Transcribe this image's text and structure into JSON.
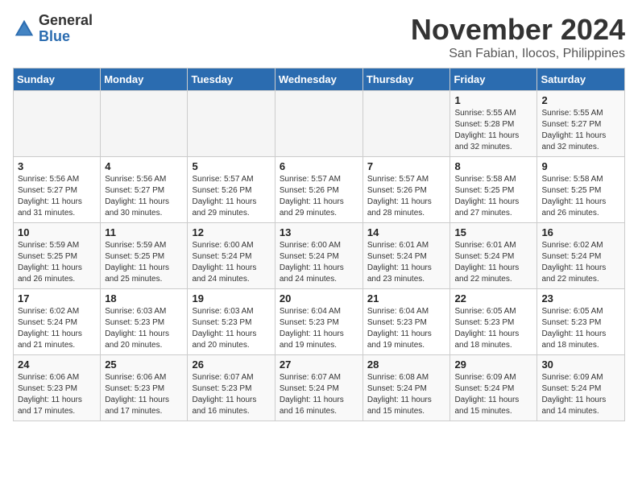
{
  "header": {
    "logo_general": "General",
    "logo_blue": "Blue",
    "month": "November 2024",
    "location": "San Fabian, Ilocos, Philippines"
  },
  "weekdays": [
    "Sunday",
    "Monday",
    "Tuesday",
    "Wednesday",
    "Thursday",
    "Friday",
    "Saturday"
  ],
  "weeks": [
    [
      {
        "day": "",
        "info": ""
      },
      {
        "day": "",
        "info": ""
      },
      {
        "day": "",
        "info": ""
      },
      {
        "day": "",
        "info": ""
      },
      {
        "day": "",
        "info": ""
      },
      {
        "day": "1",
        "info": "Sunrise: 5:55 AM\nSunset: 5:28 PM\nDaylight: 11 hours and 32 minutes."
      },
      {
        "day": "2",
        "info": "Sunrise: 5:55 AM\nSunset: 5:27 PM\nDaylight: 11 hours and 32 minutes."
      }
    ],
    [
      {
        "day": "3",
        "info": "Sunrise: 5:56 AM\nSunset: 5:27 PM\nDaylight: 11 hours and 31 minutes."
      },
      {
        "day": "4",
        "info": "Sunrise: 5:56 AM\nSunset: 5:27 PM\nDaylight: 11 hours and 30 minutes."
      },
      {
        "day": "5",
        "info": "Sunrise: 5:57 AM\nSunset: 5:26 PM\nDaylight: 11 hours and 29 minutes."
      },
      {
        "day": "6",
        "info": "Sunrise: 5:57 AM\nSunset: 5:26 PM\nDaylight: 11 hours and 29 minutes."
      },
      {
        "day": "7",
        "info": "Sunrise: 5:57 AM\nSunset: 5:26 PM\nDaylight: 11 hours and 28 minutes."
      },
      {
        "day": "8",
        "info": "Sunrise: 5:58 AM\nSunset: 5:25 PM\nDaylight: 11 hours and 27 minutes."
      },
      {
        "day": "9",
        "info": "Sunrise: 5:58 AM\nSunset: 5:25 PM\nDaylight: 11 hours and 26 minutes."
      }
    ],
    [
      {
        "day": "10",
        "info": "Sunrise: 5:59 AM\nSunset: 5:25 PM\nDaylight: 11 hours and 26 minutes."
      },
      {
        "day": "11",
        "info": "Sunrise: 5:59 AM\nSunset: 5:25 PM\nDaylight: 11 hours and 25 minutes."
      },
      {
        "day": "12",
        "info": "Sunrise: 6:00 AM\nSunset: 5:24 PM\nDaylight: 11 hours and 24 minutes."
      },
      {
        "day": "13",
        "info": "Sunrise: 6:00 AM\nSunset: 5:24 PM\nDaylight: 11 hours and 24 minutes."
      },
      {
        "day": "14",
        "info": "Sunrise: 6:01 AM\nSunset: 5:24 PM\nDaylight: 11 hours and 23 minutes."
      },
      {
        "day": "15",
        "info": "Sunrise: 6:01 AM\nSunset: 5:24 PM\nDaylight: 11 hours and 22 minutes."
      },
      {
        "day": "16",
        "info": "Sunrise: 6:02 AM\nSunset: 5:24 PM\nDaylight: 11 hours and 22 minutes."
      }
    ],
    [
      {
        "day": "17",
        "info": "Sunrise: 6:02 AM\nSunset: 5:24 PM\nDaylight: 11 hours and 21 minutes."
      },
      {
        "day": "18",
        "info": "Sunrise: 6:03 AM\nSunset: 5:23 PM\nDaylight: 11 hours and 20 minutes."
      },
      {
        "day": "19",
        "info": "Sunrise: 6:03 AM\nSunset: 5:23 PM\nDaylight: 11 hours and 20 minutes."
      },
      {
        "day": "20",
        "info": "Sunrise: 6:04 AM\nSunset: 5:23 PM\nDaylight: 11 hours and 19 minutes."
      },
      {
        "day": "21",
        "info": "Sunrise: 6:04 AM\nSunset: 5:23 PM\nDaylight: 11 hours and 19 minutes."
      },
      {
        "day": "22",
        "info": "Sunrise: 6:05 AM\nSunset: 5:23 PM\nDaylight: 11 hours and 18 minutes."
      },
      {
        "day": "23",
        "info": "Sunrise: 6:05 AM\nSunset: 5:23 PM\nDaylight: 11 hours and 18 minutes."
      }
    ],
    [
      {
        "day": "24",
        "info": "Sunrise: 6:06 AM\nSunset: 5:23 PM\nDaylight: 11 hours and 17 minutes."
      },
      {
        "day": "25",
        "info": "Sunrise: 6:06 AM\nSunset: 5:23 PM\nDaylight: 11 hours and 17 minutes."
      },
      {
        "day": "26",
        "info": "Sunrise: 6:07 AM\nSunset: 5:23 PM\nDaylight: 11 hours and 16 minutes."
      },
      {
        "day": "27",
        "info": "Sunrise: 6:07 AM\nSunset: 5:24 PM\nDaylight: 11 hours and 16 minutes."
      },
      {
        "day": "28",
        "info": "Sunrise: 6:08 AM\nSunset: 5:24 PM\nDaylight: 11 hours and 15 minutes."
      },
      {
        "day": "29",
        "info": "Sunrise: 6:09 AM\nSunset: 5:24 PM\nDaylight: 11 hours and 15 minutes."
      },
      {
        "day": "30",
        "info": "Sunrise: 6:09 AM\nSunset: 5:24 PM\nDaylight: 11 hours and 14 minutes."
      }
    ]
  ]
}
